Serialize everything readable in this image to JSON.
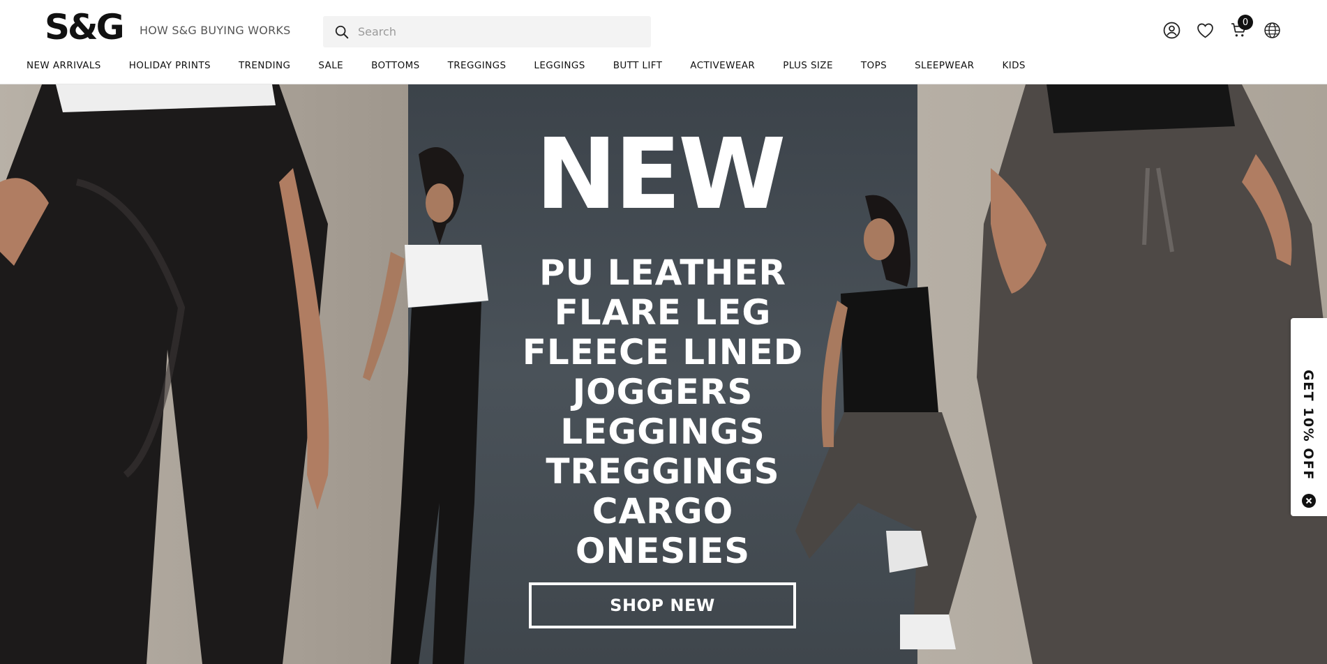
{
  "header": {
    "logo": "S&G",
    "how_link": "HOW S&G BUYING WORKS",
    "search": {
      "placeholder": "Search",
      "value": ""
    },
    "icons": [
      "account-icon",
      "heart-icon",
      "cart-icon",
      "globe-icon"
    ],
    "cart_count": "0"
  },
  "nav": {
    "items": [
      {
        "label": "NEW ARRIVALS"
      },
      {
        "label": "HOLIDAY PRINTS"
      },
      {
        "label": "TRENDING"
      },
      {
        "label": "SALE"
      },
      {
        "label": "BOTTOMS"
      },
      {
        "label": "TREGGINGS"
      },
      {
        "label": "LEGGINGS"
      },
      {
        "label": "BUTT LIFT"
      },
      {
        "label": "ACTIVEWEAR"
      },
      {
        "label": "PLUS SIZE"
      },
      {
        "label": "TOPS"
      },
      {
        "label": "SLEEPWEAR"
      },
      {
        "label": "KIDS"
      }
    ]
  },
  "hero": {
    "headline": "NEW",
    "items": [
      "PU LEATHER",
      "FLARE LEG",
      "FLEECE LINED",
      "JOGGERS",
      "LEGGINGS",
      "TREGGINGS",
      "CARGO",
      "ONESIES"
    ],
    "cta": "SHOP NEW",
    "colors": {
      "panel": "#444b52",
      "background": "#b3aca3",
      "text": "#ffffff"
    }
  },
  "promo": {
    "label": "GET 10% OFF"
  }
}
